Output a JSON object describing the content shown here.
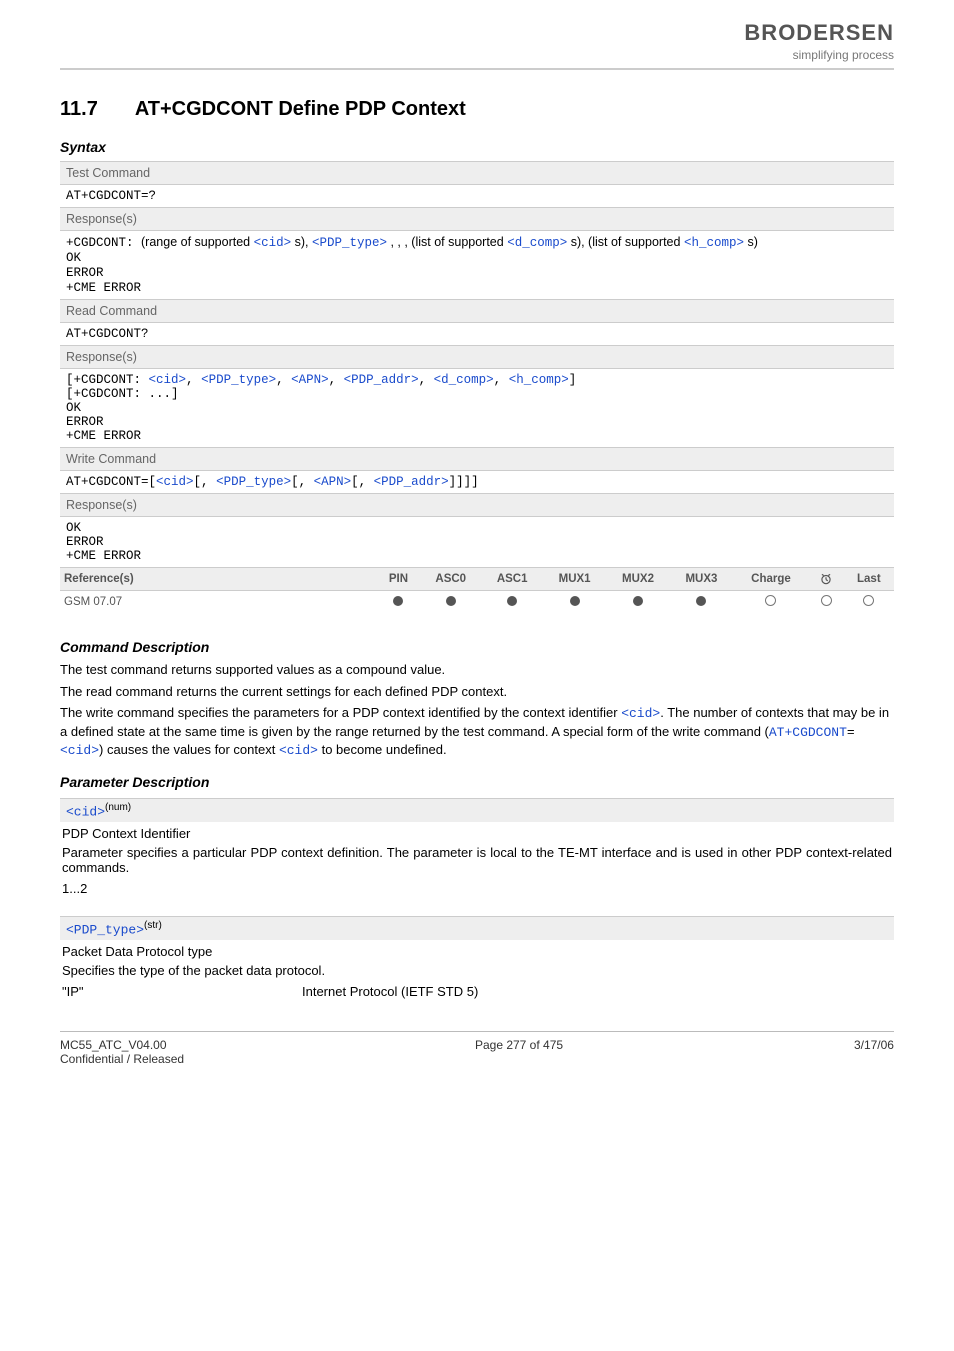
{
  "header": {
    "brand_name": "BRODERSEN",
    "brand_sub": "simplifying process"
  },
  "section": {
    "number": "11.7",
    "title": "AT+CGDCONT   Define PDP Context"
  },
  "syntax_heading": "Syntax",
  "test_cmd": {
    "label": "Test Command",
    "cmd": "AT+CGDCONT=?",
    "resp_label": "Response(s)",
    "resp_prefix": "+CGDCONT: ",
    "resp_seg1": "(range of supported",
    "p_cid": "<cid>",
    "s_after_cid": "s), ",
    "p_pdp_type": "<PDP_type>",
    "resp_seg2": ", , , (list of supported ",
    "p_dcomp": "<d_comp>",
    "s_after_dcomp": "s), (list of supported ",
    "p_hcomp": "<h_comp>",
    "s_after_hcomp": "s)",
    "ok": "OK",
    "error": "ERROR",
    "cme": "+CME ERROR"
  },
  "read_cmd": {
    "label": "Read Command",
    "cmd": "AT+CGDCONT?",
    "resp_label": "Response(s)",
    "open_br": "[",
    "resp_prefix": "+CGDCONT: ",
    "p_cid": "<cid>",
    "sep": ", ",
    "p_pdp_type": "<PDP_type>",
    "p_apn": "<APN>",
    "p_pdp_addr": "<PDP_addr>",
    "p_dcomp": "<d_comp>",
    "p_hcomp": "<h_comp>",
    "close_br": "]",
    "line2": "[+CGDCONT: ...]",
    "ok": "OK",
    "error": "ERROR",
    "cme": "+CME ERROR"
  },
  "write_cmd": {
    "label": "Write Command",
    "cmd_prefix": "AT+CGDCONT=",
    "open_br": "[",
    "p_cid": "<cid>",
    "sep": "[, ",
    "p_pdp_type": "<PDP_type>",
    "p_apn": "<APN>",
    "p_pdp_addr": "<PDP_addr>",
    "close": "]]]]",
    "resp_label": "Response(s)",
    "ok": "OK",
    "error": "ERROR",
    "cme": "+CME ERROR"
  },
  "ref_table": {
    "header_ref": "Reference(s)",
    "cols": [
      "PIN",
      "ASC0",
      "ASC1",
      "MUX1",
      "MUX2",
      "MUX3",
      "Charge",
      "alarm",
      "Last"
    ],
    "row_label": "GSM 07.07",
    "dots": [
      "filled",
      "filled",
      "filled",
      "filled",
      "filled",
      "filled",
      "empty",
      "empty",
      "empty"
    ]
  },
  "cmd_desc": {
    "heading": "Command Description",
    "p1": "The test command returns supported values as a compound value.",
    "p2": "The read command returns the current settings for each defined PDP context.",
    "p3_a": "The write command specifies the parameters for a PDP context identified by the context identifier ",
    "p3_cid": "<cid>",
    "p3_b": ". The number of contexts that may be in a defined state at the same time is given by the range returned by the test command. A special form of the write command (",
    "p3_cmd": "AT+CGDCONT",
    "p3_eq": "=",
    "p3_cid2": "<cid>",
    "p3_c": ") causes the values for context ",
    "p3_cid3": "<cid>",
    "p3_d": " to become undefined."
  },
  "param_desc": {
    "heading": "Parameter Description",
    "cid": {
      "tag": "<cid>",
      "sup": "(num)",
      "title": "PDP Context Identifier",
      "body": "Parameter specifies a particular PDP context definition. The parameter is local to the TE-MT interface and is used in other PDP context-related commands.",
      "range": "1...2"
    },
    "pdp_type": {
      "tag": "<PDP_type>",
      "sup": "(str)",
      "title": "Packet Data Protocol type",
      "body": "Specifies the type of the packet data protocol.",
      "key": "\"IP\"",
      "val": "Internet Protocol (IETF STD 5)"
    }
  },
  "footer": {
    "left1": "MC55_ATC_V04.00",
    "left2": "Confidential / Released",
    "center": "Page 277 of 475",
    "right": "3/17/06"
  }
}
